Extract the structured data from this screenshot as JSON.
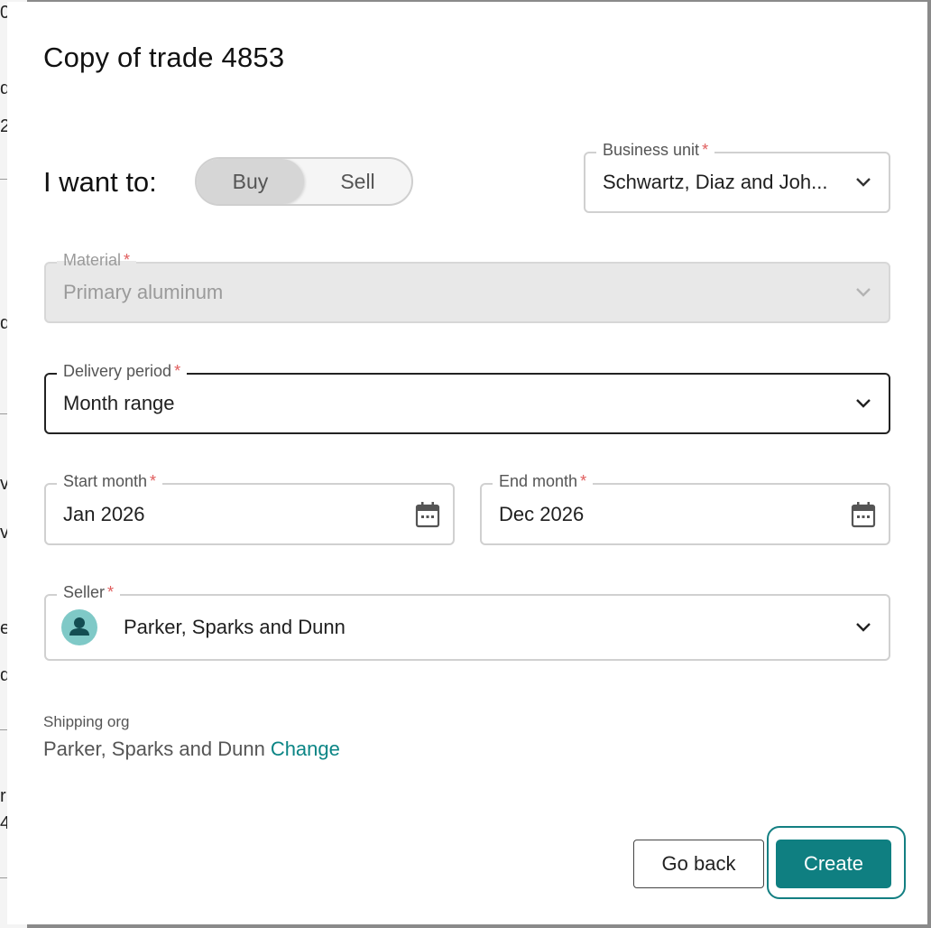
{
  "dialog": {
    "title": "Copy of trade 4853",
    "i_want_label": "I want to:",
    "toggle": {
      "options": [
        "Buy",
        "Sell"
      ],
      "selected": "Buy"
    },
    "business_unit": {
      "label": "Business unit",
      "value": "Schwartz, Diaz and Joh..."
    },
    "material": {
      "label": "Material",
      "value": "Primary aluminum",
      "disabled": true
    },
    "delivery_period": {
      "label": "Delivery period",
      "value": "Month range"
    },
    "start_month": {
      "label": "Start month",
      "value": "Jan 2026"
    },
    "end_month": {
      "label": "End month",
      "value": "Dec 2026"
    },
    "seller": {
      "label": "Seller",
      "value": "Parker, Sparks and Dunn"
    },
    "required_mark": "*",
    "shipping": {
      "label": "Shipping org",
      "value": "Parker, Sparks and Dunn",
      "change_link": "Change"
    },
    "buttons": {
      "back": "Go back",
      "create": "Create"
    }
  },
  "background_fragments": [
    "0",
    "d",
    "2",
    "d",
    "v",
    "v",
    "e",
    "d",
    "r",
    "4"
  ],
  "colors": {
    "accent": "#0f7f81",
    "required": "#e05c5c",
    "disabled_bg": "#e8e8e8"
  },
  "icons": {
    "dropdown": "chevron-down-icon",
    "calendar": "calendar-icon",
    "avatar": "person-icon"
  }
}
